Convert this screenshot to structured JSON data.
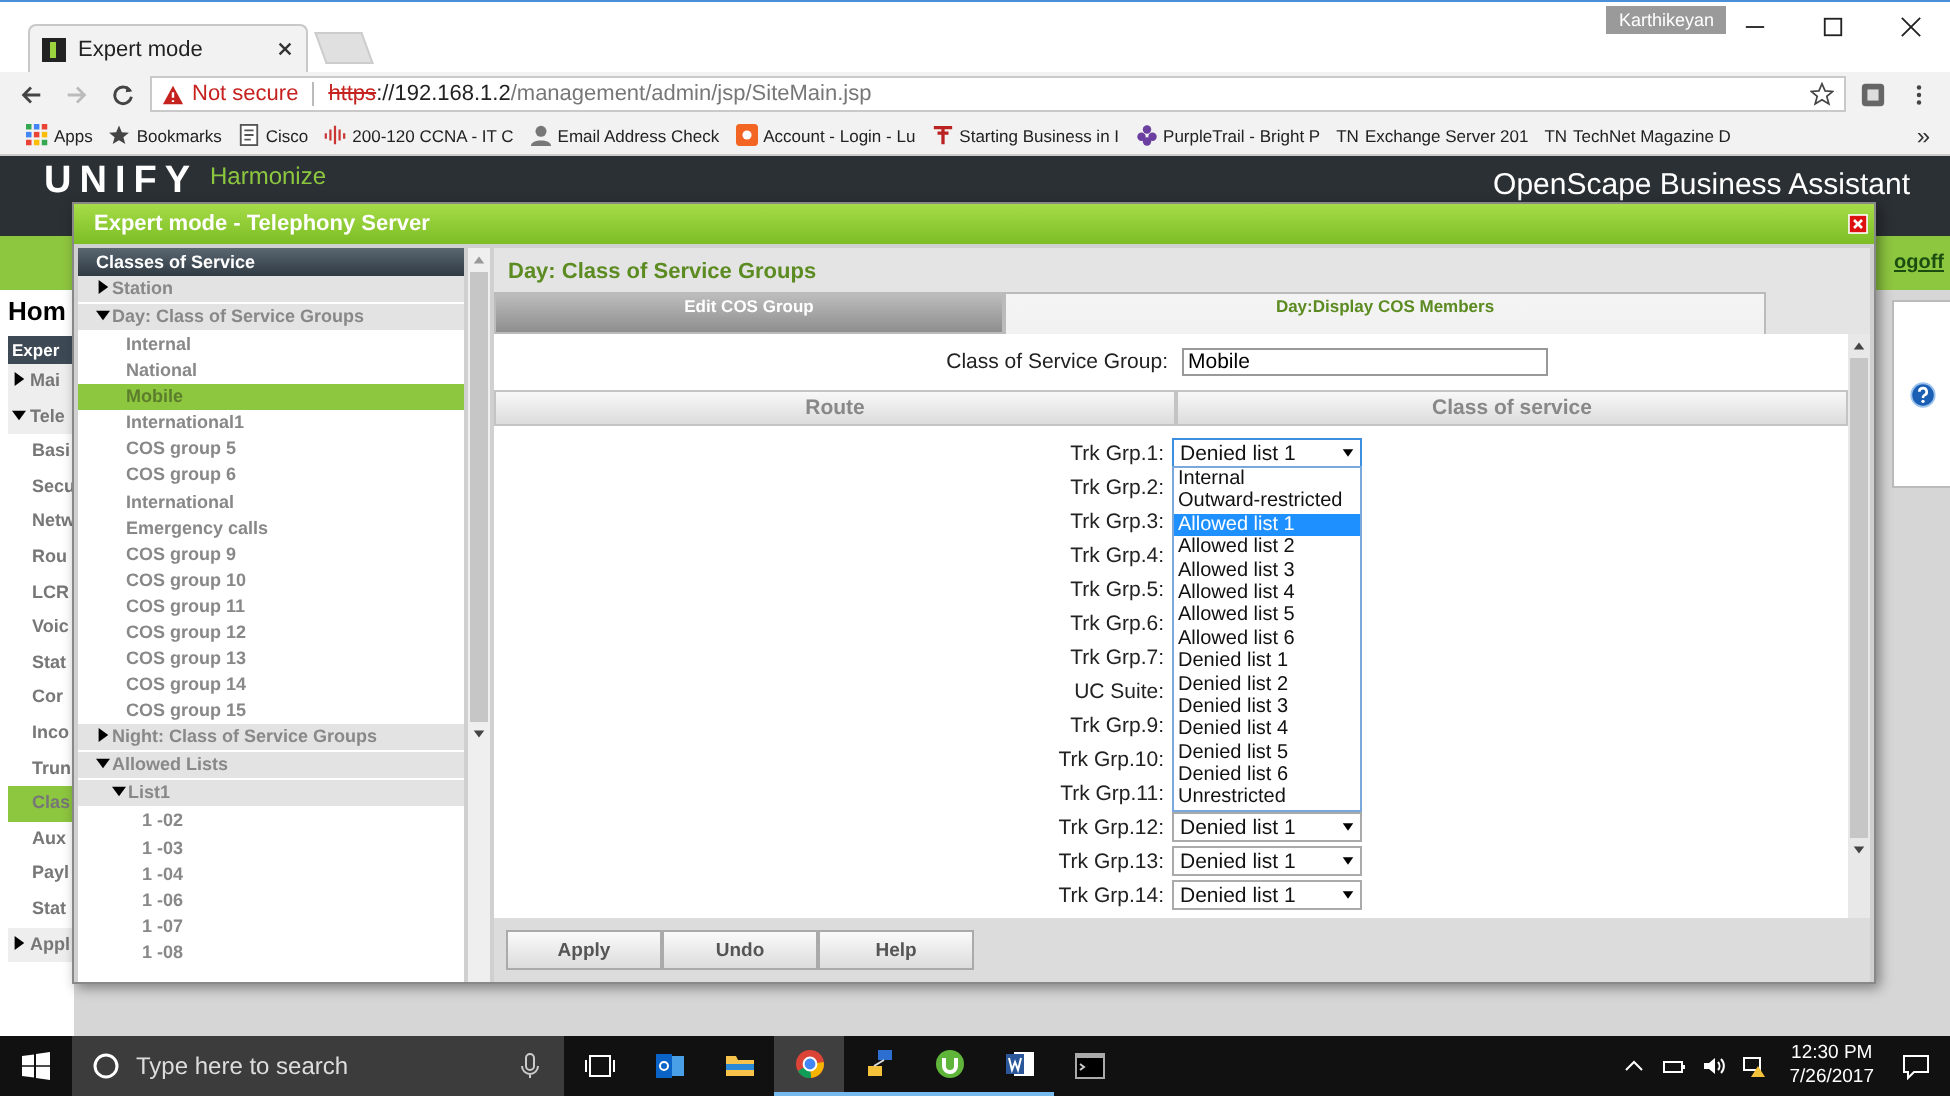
{
  "browser": {
    "tab_title": "Expert mode",
    "profile": "Karthikeyan",
    "security": "Not secure",
    "url_scheme": "https",
    "url_host": "://192.168.1.2",
    "url_path": "/management/admin/jsp/SiteMain.jsp",
    "bookmarks": [
      {
        "kind": "apps",
        "label": "Apps"
      },
      {
        "kind": "star",
        "label": "Bookmarks"
      },
      {
        "kind": "doc",
        "label": "Cisco"
      },
      {
        "kind": "bars",
        "label": "200-120 CCNA - IT C"
      },
      {
        "kind": "person",
        "label": "Email Address Check"
      },
      {
        "kind": "shield",
        "label": "Account - Login - Lu"
      },
      {
        "kind": "tree",
        "label": "Starting Business in I"
      },
      {
        "kind": "flower",
        "label": "PurpleTrail - Bright P"
      },
      {
        "kind": "text",
        "icon_text": "TN",
        "label": "Exchange Server 201"
      },
      {
        "kind": "text",
        "icon_text": "TN",
        "label": "TechNet Magazine D"
      }
    ],
    "more": "»"
  },
  "app": {
    "logo": "UNIFY",
    "logo_sub": "Harmonize",
    "title": "OpenScape Business Assistant",
    "logoff": "ogoff",
    "home": "Hom",
    "nav_header": "Exper",
    "nav": [
      {
        "kind": "group",
        "label": "Mai",
        "expanded": false,
        "selected": false
      },
      {
        "kind": "group",
        "label": "Tele",
        "expanded": true,
        "selected": false
      },
      {
        "kind": "item",
        "label": "Basi",
        "selected": false
      },
      {
        "kind": "item",
        "label": "Secu",
        "selected": false
      },
      {
        "kind": "item",
        "label": "Netw",
        "selected": false
      },
      {
        "kind": "item",
        "label": "Rou",
        "selected": false
      },
      {
        "kind": "item",
        "label": "LCR",
        "selected": false
      },
      {
        "kind": "item",
        "label": "Voic",
        "selected": false
      },
      {
        "kind": "item",
        "label": "Stat",
        "selected": false
      },
      {
        "kind": "item",
        "label": "Cor",
        "selected": false
      },
      {
        "kind": "item",
        "label": "Inco",
        "selected": false
      },
      {
        "kind": "item",
        "label": "Trun",
        "selected": false
      },
      {
        "kind": "item",
        "label": "Clas",
        "selected": true
      },
      {
        "kind": "item",
        "label": "Aux",
        "selected": false
      },
      {
        "kind": "item",
        "label": "Payl",
        "selected": false
      },
      {
        "kind": "item",
        "label": "Stat",
        "selected": false
      },
      {
        "kind": "group",
        "label": "Appl",
        "expanded": false,
        "selected": false
      }
    ]
  },
  "dialog": {
    "title": "Expert mode - Telephony Server",
    "tree_title": "Classes of Service",
    "tree": [
      {
        "kind": "group",
        "label": "Station",
        "expanded": false
      },
      {
        "kind": "group",
        "label": "Day: Class of Service Groups",
        "expanded": true,
        "children": [
          {
            "kind": "leaf",
            "label": "Internal",
            "selected": false
          },
          {
            "kind": "leaf",
            "label": "National",
            "selected": false
          },
          {
            "kind": "leaf",
            "label": "Mobile",
            "selected": true
          },
          {
            "kind": "leaf",
            "label": "International1",
            "selected": false
          },
          {
            "kind": "leaf",
            "label": "COS group 5",
            "selected": false
          },
          {
            "kind": "leaf",
            "label": "COS group 6",
            "selected": false
          },
          {
            "kind": "leaf",
            "label": "International",
            "selected": false
          },
          {
            "kind": "leaf",
            "label": "Emergency calls",
            "selected": false
          },
          {
            "kind": "leaf",
            "label": "COS group 9",
            "selected": false
          },
          {
            "kind": "leaf",
            "label": "COS group 10",
            "selected": false
          },
          {
            "kind": "leaf",
            "label": "COS group 11",
            "selected": false
          },
          {
            "kind": "leaf",
            "label": "COS group 12",
            "selected": false
          },
          {
            "kind": "leaf",
            "label": "COS group 13",
            "selected": false
          },
          {
            "kind": "leaf",
            "label": "COS group 14",
            "selected": false
          },
          {
            "kind": "leaf",
            "label": "COS group 15",
            "selected": false
          }
        ]
      },
      {
        "kind": "group",
        "label": "Night: Class of Service Groups",
        "expanded": false
      },
      {
        "kind": "group",
        "label": "Allowed Lists",
        "expanded": true,
        "children": [
          {
            "kind": "group",
            "label": "List1",
            "expanded": true,
            "children": [
              {
                "kind": "leaf",
                "label": "1 -02",
                "selected": false
              },
              {
                "kind": "leaf",
                "label": "1 -03",
                "selected": false
              },
              {
                "kind": "leaf",
                "label": "1 -04",
                "selected": false
              },
              {
                "kind": "leaf",
                "label": "1 -06",
                "selected": false
              },
              {
                "kind": "leaf",
                "label": "1 -07",
                "selected": false
              },
              {
                "kind": "leaf",
                "label": "1 -08",
                "selected": false
              }
            ]
          }
        ]
      }
    ],
    "heading": "Day: Class of Service Groups",
    "tabs": [
      {
        "label": "Edit COS Group",
        "selected": true
      },
      {
        "label": "Day:Display COS Members",
        "selected": false
      }
    ],
    "group_label": "Class of Service Group:",
    "group_value": "Mobile",
    "columns": [
      "Route",
      "Class of service"
    ],
    "rows": [
      {
        "label": "Trk Grp.1:",
        "value": "Denied list 1",
        "open": true
      },
      {
        "label": "Trk Grp.2:"
      },
      {
        "label": "Trk Grp.3:"
      },
      {
        "label": "Trk Grp.4:"
      },
      {
        "label": "Trk Grp.5:"
      },
      {
        "label": "Trk Grp.6:"
      },
      {
        "label": "Trk Grp.7:"
      },
      {
        "label": "UC Suite:"
      },
      {
        "label": "Trk Grp.9:"
      },
      {
        "label": "Trk Grp.10:"
      },
      {
        "label": "Trk Grp.11:"
      },
      {
        "label": "Trk Grp.12:",
        "value": "Denied list 1",
        "open": false
      },
      {
        "label": "Trk Grp.13:",
        "value": "Denied list 1",
        "open": false
      },
      {
        "label": "Trk Grp.14:",
        "value": "Denied list 1",
        "open": false
      }
    ],
    "options": [
      {
        "label": "Internal",
        "selected": false
      },
      {
        "label": "Outward-restricted",
        "selected": false
      },
      {
        "label": "Allowed list 1",
        "selected": true
      },
      {
        "label": "Allowed list 2",
        "selected": false
      },
      {
        "label": "Allowed list 3",
        "selected": false
      },
      {
        "label": "Allowed list 4",
        "selected": false
      },
      {
        "label": "Allowed list 5",
        "selected": false
      },
      {
        "label": "Allowed list 6",
        "selected": false
      },
      {
        "label": "Denied list 1",
        "selected": false
      },
      {
        "label": "Denied list 2",
        "selected": false
      },
      {
        "label": "Denied list 3",
        "selected": false
      },
      {
        "label": "Denied list 4",
        "selected": false
      },
      {
        "label": "Denied list 5",
        "selected": false
      },
      {
        "label": "Denied list 6",
        "selected": false
      },
      {
        "label": "Unrestricted",
        "selected": false
      }
    ],
    "buttons": [
      "Apply",
      "Undo",
      "Help"
    ]
  },
  "taskbar": {
    "search_placeholder": "Type here to search",
    "apps": [
      {
        "kind": "taskview",
        "running": false,
        "selected": false
      },
      {
        "kind": "mail",
        "running": false,
        "selected": false
      },
      {
        "kind": "folder",
        "running": false,
        "selected": false
      },
      {
        "kind": "browser",
        "running": true,
        "selected": true
      },
      {
        "kind": "network",
        "running": true,
        "selected": false
      },
      {
        "kind": "torrent",
        "running": true,
        "selected": false
      },
      {
        "kind": "word",
        "running": true,
        "selected": false
      },
      {
        "kind": "terminal",
        "running": false,
        "selected": false
      }
    ],
    "time": "12:30 PM",
    "date": "7/26/2017"
  }
}
